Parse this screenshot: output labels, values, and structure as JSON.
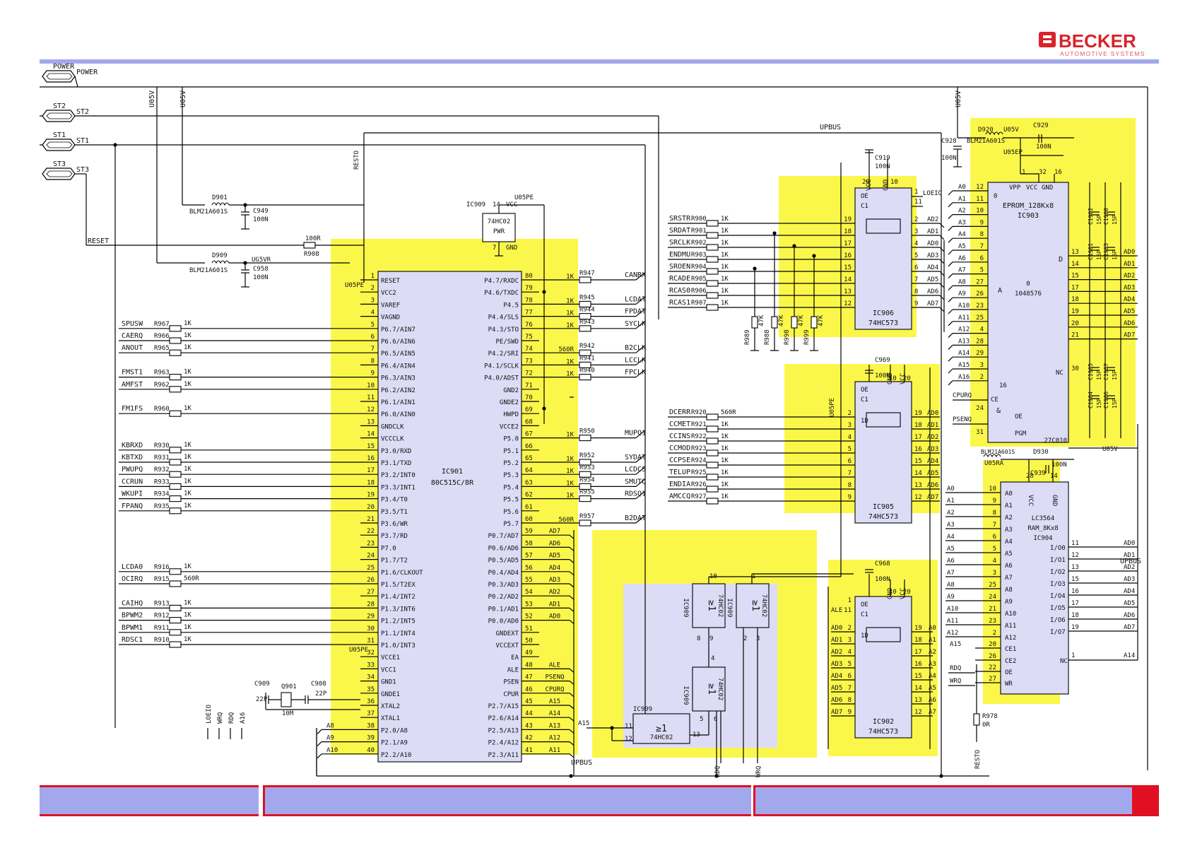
{
  "brand": {
    "name": "BECKER",
    "tagline": "AUTOMOTIVE SYSTEMS",
    "color_red": "#d8232a",
    "color_accent": "#a3a8ec",
    "color_highlight": "#fbf74a",
    "color_chip": "#dcdcf6"
  },
  "connectors": [
    {
      "id": "POWER",
      "net": "POWER"
    },
    {
      "id": "ST2",
      "net": "ST2"
    },
    {
      "id": "ST1",
      "net": "ST1"
    },
    {
      "id": "ST3",
      "net": "ST3"
    }
  ],
  "nets": {
    "reset": "RESET",
    "resto": "RESTO",
    "u05v_a": "U05V",
    "u05v_b": "U05V",
    "u05v_right": "U05V",
    "upbus_top": "UPBUS",
    "upbus_mid": "UPBUS",
    "upbus_right": "UPBUS",
    "u05pe_a": "U05PE",
    "u05pe_b": "U05PE",
    "u05pe_c": "U05PE",
    "u05pe_d": "U05PE",
    "u05pe_e": "U05PE",
    "u05ep": "U05EP",
    "u05ra": "U05RA",
    "ug5vr": "UG5VR",
    "loeio": "LOEIO",
    "wrq": "WRQ",
    "rdq": "RDQ",
    "a16": "A16",
    "a15": "A15",
    "rdq_bottom": "RDQ",
    "wrq_bottom": "WRQ",
    "resto_bottom": "RESTO",
    "ale": "ALE",
    "psenq": "PSENQ",
    "cpurq": "CPURQ",
    "rdq_right": "RDQ",
    "wrq_right": "WRQ"
  },
  "passives": {
    "d901": "D901",
    "d901_type": "BLM21A601S",
    "d909": "D909",
    "d909_type": "BLM21A601S",
    "d920": "D920",
    "d920_type": "BLM21A601S",
    "d930": "D930",
    "d930_type": "BLM21A601S",
    "c949": "C949",
    "c949_val": "100N",
    "c958": "C958",
    "c958_val": "100N",
    "c919": "C919",
    "c919_val": "100N",
    "c928": "C928",
    "c928_val": "100N",
    "c929": "C929",
    "c929_val": "100N",
    "c969": "C969",
    "c969_val": "100N",
    "c968": "C968",
    "c968_val": "100N",
    "c939": "C939",
    "c939_val": "100N",
    "c909": "C909",
    "c909_val": "22P",
    "c908": "C908",
    "c908_val": "22P",
    "q901": "Q901",
    "q901_val": "10M",
    "r908": "R908",
    "r908_val": "100R",
    "r978": "R978",
    "r978_val": "0R",
    "r989": "R989",
    "r988": "R988",
    "r998": "R998",
    "r999": "R999",
    "r47k": "47K",
    "c1902": "C1902",
    "c1900": "C1900",
    "c1901": "C1901",
    "c1903": "C1903",
    "c1905": "C1905",
    "c1907": "C1907",
    "c1904": "C1904",
    "c1906": "C1906",
    "c15p": "15P"
  },
  "left_signals": [
    {
      "net": "SPUSW",
      "res": "R967",
      "val": "1K",
      "pin": "5"
    },
    {
      "net": "CAERQ",
      "res": "R966",
      "val": "1K",
      "pin": "6"
    },
    {
      "net": "ANOUT",
      "res": "R965",
      "val": "1K",
      "pin": "7"
    },
    {
      "net": "FMST1",
      "res": "R963",
      "val": "1K",
      "pin": "9"
    },
    {
      "net": "AMFST",
      "res": "R962",
      "val": "1K",
      "pin": "10"
    },
    {
      "net": "FM1FS",
      "res": "R960",
      "val": "1K",
      "pin": "12"
    },
    {
      "net": "KBRXD",
      "res": "R930",
      "val": "1K",
      "pin": "15"
    },
    {
      "net": "KBTXD",
      "res": "R931",
      "val": "1K",
      "pin": "16"
    },
    {
      "net": "PWUPQ",
      "res": "R932",
      "val": "1K",
      "pin": "17"
    },
    {
      "net": "CCRUN",
      "res": "R933",
      "val": "1K",
      "pin": "18"
    },
    {
      "net": "WKUPI",
      "res": "R934",
      "val": "1K",
      "pin": "19"
    },
    {
      "net": "FPANQ",
      "res": "R935",
      "val": "1K",
      "pin": "20"
    },
    {
      "net": "LCDA0",
      "res": "R916",
      "val": "1K",
      "pin": "25"
    },
    {
      "net": "OCIRQ",
      "res": "R915",
      "val": "560R",
      "pin": "26"
    },
    {
      "net": "CAIHQ",
      "res": "R913",
      "val": "1K",
      "pin": "28"
    },
    {
      "net": "BPWM2",
      "res": "R912",
      "val": "1K",
      "pin": "29"
    },
    {
      "net": "BPWM1",
      "res": "R911",
      "val": "1K",
      "pin": "30"
    },
    {
      "net": "RDSC1",
      "res": "R910",
      "val": "1K",
      "pin": "31"
    }
  ],
  "ic901": {
    "ref": "IC901",
    "part": "80C515C/8R",
    "left_pins": [
      {
        "n": "1",
        "name": "RESET"
      },
      {
        "n": "2",
        "name": "VCC2"
      },
      {
        "n": "3",
        "name": "VAREF"
      },
      {
        "n": "4",
        "name": "VAGND"
      },
      {
        "n": "5",
        "name": "P6.7/AIN7"
      },
      {
        "n": "6",
        "name": "P6.6/AIN6"
      },
      {
        "n": "7",
        "name": "P6.5/AIN5"
      },
      {
        "n": "8",
        "name": "P6.4/AIN4"
      },
      {
        "n": "9",
        "name": "P6.3/AIN3"
      },
      {
        "n": "10",
        "name": "P6.2/AIN2"
      },
      {
        "n": "11",
        "name": "P6.1/AIN1"
      },
      {
        "n": "12",
        "name": "P6.0/AIN0"
      },
      {
        "n": "13",
        "name": "GNDCLK"
      },
      {
        "n": "14",
        "name": "VCCCLK"
      },
      {
        "n": "15",
        "name": "P3.0/RXD"
      },
      {
        "n": "16",
        "name": "P3.1/TXD"
      },
      {
        "n": "17",
        "name": "P3.2/INT0"
      },
      {
        "n": "18",
        "name": "P3.3/INT1"
      },
      {
        "n": "19",
        "name": "P3.4/T0"
      },
      {
        "n": "20",
        "name": "P3.5/T1"
      },
      {
        "n": "21",
        "name": "P3.6/WR"
      },
      {
        "n": "22",
        "name": "P3.7/RD"
      },
      {
        "n": "23",
        "name": "P7.0"
      },
      {
        "n": "24",
        "name": "P1.7/T2"
      },
      {
        "n": "25",
        "name": "P1.6/CLKOUT"
      },
      {
        "n": "26",
        "name": "P1.5/T2EX"
      },
      {
        "n": "27",
        "name": "P1.4/INT2"
      },
      {
        "n": "28",
        "name": "P1.3/INT6"
      },
      {
        "n": "29",
        "name": "P1.2/INT5"
      },
      {
        "n": "30",
        "name": "P1.1/INT4"
      },
      {
        "n": "31",
        "name": "P1.0/INT3"
      },
      {
        "n": "32",
        "name": "VCCE1"
      },
      {
        "n": "33",
        "name": "VCC1"
      },
      {
        "n": "34",
        "name": "GND1"
      },
      {
        "n": "35",
        "name": "GNDE1"
      },
      {
        "n": "36",
        "name": "XTAL2"
      },
      {
        "n": "37",
        "name": "XTAL1"
      },
      {
        "n": "38",
        "name": "P2.0/A8"
      },
      {
        "n": "39",
        "name": "P2.1/A9"
      },
      {
        "n": "40",
        "name": "P2.2/A10"
      }
    ],
    "right_pins": [
      {
        "n": "80",
        "name": "P4.7/RXDC",
        "res": "R947",
        "rv": "1K",
        "net": "CANRX"
      },
      {
        "n": "79",
        "name": "P4.6/TXDC",
        "res": "",
        "rv": "",
        "net": ""
      },
      {
        "n": "78",
        "name": "P4.5",
        "res": "R945",
        "rv": "1K",
        "net": "LCDAT"
      },
      {
        "n": "77",
        "name": "P4.4/SLS",
        "res": "R944",
        "rv": "1K",
        "net": "FPDAT"
      },
      {
        "n": "76",
        "name": "P4.3/STO",
        "res": "R943",
        "rv": "1K",
        "net": "SYCLK"
      },
      {
        "n": "75",
        "name": "PE/SWD",
        "res": "",
        "rv": "",
        "net": ""
      },
      {
        "n": "74",
        "name": "P4.2/SRI",
        "res": "R942",
        "rv": "560R",
        "net": "B2CLK"
      },
      {
        "n": "73",
        "name": "P4.1/SCLK",
        "res": "R941",
        "rv": "1K",
        "net": "LCCLK"
      },
      {
        "n": "72",
        "name": "P4.0/ADST",
        "res": "R940",
        "rv": "1K",
        "net": "FPCLK"
      },
      {
        "n": "71",
        "name": "GND2",
        "res": "",
        "rv": "",
        "net": ""
      },
      {
        "n": "70",
        "name": "GNDE2",
        "res": "",
        "rv": "",
        "net": ""
      },
      {
        "n": "69",
        "name": "HWPD",
        "res": "",
        "rv": "",
        "net": ""
      },
      {
        "n": "68",
        "name": "VCCE2",
        "res": "",
        "rv": "",
        "net": ""
      },
      {
        "n": "67",
        "name": "P5.0",
        "res": "R950",
        "rv": "1K",
        "net": "MUPQ1"
      },
      {
        "n": "66",
        "name": "P5.1",
        "res": "",
        "rv": "",
        "net": ""
      },
      {
        "n": "65",
        "name": "P5.2",
        "res": "R952",
        "rv": "1K",
        "net": "SYDAT"
      },
      {
        "n": "64",
        "name": "P5.3",
        "res": "R953",
        "rv": "1K",
        "net": "LCDCS"
      },
      {
        "n": "63",
        "name": "P5.4",
        "res": "R954",
        "rv": "1K",
        "net": "SMUTQ"
      },
      {
        "n": "62",
        "name": "P5.5",
        "res": "R955",
        "rv": "1K",
        "net": "RDSQ1"
      },
      {
        "n": "61",
        "name": "P5.6",
        "res": "",
        "rv": "",
        "net": ""
      },
      {
        "n": "60",
        "name": "P5.7",
        "res": "R957",
        "rv": "560R",
        "net": "B2DAT"
      },
      {
        "n": "59",
        "name": "P0.7/AD7",
        "res": "",
        "rv": "",
        "net": "AD7"
      },
      {
        "n": "58",
        "name": "P0.6/AD6",
        "res": "",
        "rv": "",
        "net": "AD6"
      },
      {
        "n": "57",
        "name": "P0.5/AD5",
        "res": "",
        "rv": "",
        "net": "AD5"
      },
      {
        "n": "56",
        "name": "P0.4/AD4",
        "res": "",
        "rv": "",
        "net": "AD4"
      },
      {
        "n": "55",
        "name": "P0.3/AD3",
        "res": "",
        "rv": "",
        "net": "AD3"
      },
      {
        "n": "54",
        "name": "P0.2/AD2",
        "res": "",
        "rv": "",
        "net": "AD2"
      },
      {
        "n": "53",
        "name": "P0.1/AD1",
        "res": "",
        "rv": "",
        "net": "AD1"
      },
      {
        "n": "52",
        "name": "P0.0/AD0",
        "res": "",
        "rv": "",
        "net": "AD0"
      },
      {
        "n": "51",
        "name": "GNDEXT",
        "res": "",
        "rv": "",
        "net": ""
      },
      {
        "n": "50",
        "name": "VCCEXT",
        "res": "",
        "rv": "",
        "net": ""
      },
      {
        "n": "49",
        "name": "EA",
        "res": "",
        "rv": "",
        "net": ""
      },
      {
        "n": "48",
        "name": "ALE",
        "res": "",
        "rv": "",
        "net": "ALE"
      },
      {
        "n": "47",
        "name": "PSEN",
        "res": "",
        "rv": "",
        "net": "PSENQ"
      },
      {
        "n": "46",
        "name": "CPUR",
        "res": "",
        "rv": "",
        "net": "CPURQ"
      },
      {
        "n": "45",
        "name": "P2.7/A15",
        "res": "",
        "rv": "",
        "net": "A15"
      },
      {
        "n": "44",
        "name": "P2.6/A14",
        "res": "",
        "rv": "",
        "net": "A14"
      },
      {
        "n": "43",
        "name": "P2.5/A13",
        "res": "",
        "rv": "",
        "net": "A13"
      },
      {
        "n": "42",
        "name": "P2.4/A12",
        "res": "",
        "rv": "",
        "net": "A12"
      },
      {
        "n": "41",
        "name": "P2.3/A11",
        "res": "",
        "rv": "",
        "net": "A11"
      }
    ],
    "bottom_left_nets": [
      "A8",
      "A9",
      "A10"
    ]
  },
  "ic909_pwr": {
    "ref": "IC909",
    "part": "74HC02",
    "sub": "PWR",
    "pin14": "14",
    "pin7": "7",
    "vcc": "VCC",
    "gnd": "GND"
  },
  "ic906": {
    "ref": "IC906",
    "part": "74HC573",
    "pins_top": [
      "20",
      "10"
    ],
    "pins_top_names": [
      "VCC",
      "GND"
    ],
    "oe": "OE",
    "c1": "C1",
    "oe_pin": "1",
    "c1_pin": "11",
    "rows": [
      {
        "net": "SRSTR",
        "res": "R900",
        "rv": "1K",
        "in": "19",
        "out": "2",
        "ad": "AD2"
      },
      {
        "net": "SRDAT",
        "res": "R901",
        "rv": "1K",
        "in": "18",
        "out": "3",
        "ad": "AD1"
      },
      {
        "net": "SRCLK",
        "res": "R902",
        "rv": "1K",
        "in": "17",
        "out": "4",
        "ad": "AD0"
      },
      {
        "net": "ENDMU",
        "res": "R903",
        "rv": "1K",
        "in": "16",
        "out": "5",
        "ad": "AD3"
      },
      {
        "net": "SROEN",
        "res": "R904",
        "rv": "1K",
        "in": "15",
        "out": "6",
        "ad": "AD4"
      },
      {
        "net": "RCADE",
        "res": "R905",
        "rv": "1K",
        "in": "14",
        "out": "7",
        "ad": "AD5"
      },
      {
        "net": "RCAS0",
        "res": "R906",
        "rv": "1K",
        "in": "13",
        "out": "8",
        "ad": "AD6"
      },
      {
        "net": "RCAS1",
        "res": "R907",
        "rv": "1K",
        "in": "12",
        "out": "9",
        "ad": "AD7"
      }
    ]
  },
  "ic905": {
    "ref": "IC905",
    "part": "74HC573",
    "pins_top": [
      "10",
      "20"
    ],
    "pins_top_names": [
      "GND",
      "VCC"
    ],
    "oe": "OE",
    "c1": "C1",
    "d": "1D",
    "rows": [
      {
        "net": "DCERR",
        "res": "R920",
        "rv": "560R",
        "in": "2",
        "out": "19",
        "ad": "AD0"
      },
      {
        "net": "CCMET",
        "res": "R921",
        "rv": "1K",
        "in": "3",
        "out": "18",
        "ad": "AD1"
      },
      {
        "net": "CCINS",
        "res": "R922",
        "rv": "1K",
        "in": "4",
        "out": "17",
        "ad": "AD2"
      },
      {
        "net": "CCMOD",
        "res": "R923",
        "rv": "1K",
        "in": "5",
        "out": "16",
        "ad": "AD3"
      },
      {
        "net": "CCPSE",
        "res": "R924",
        "rv": "1K",
        "in": "6",
        "out": "15",
        "ad": "AD4"
      },
      {
        "net": "TELUP",
        "res": "R925",
        "rv": "1K",
        "in": "7",
        "out": "14",
        "ad": "AD5"
      },
      {
        "net": "ENDIA",
        "res": "R926",
        "rv": "1K",
        "in": "8",
        "out": "13",
        "ad": "AD6"
      },
      {
        "net": "AMCCQ",
        "res": "R927",
        "rv": "1K",
        "in": "9",
        "out": "12",
        "ad": "AD7"
      }
    ]
  },
  "ic902": {
    "ref": "IC902",
    "part": "74HC573",
    "pins_top": [
      "10",
      "20"
    ],
    "pins_top_names": [
      "GND",
      "VCC"
    ],
    "oe": "OE",
    "c1": "C1",
    "d": "1D",
    "oe_pin": "1",
    "c1_pin": "11",
    "rows": [
      {
        "in_net": "AD0",
        "in": "2",
        "out": "19",
        "a": "A0"
      },
      {
        "in_net": "AD1",
        "in": "3",
        "out": "18",
        "a": "A1"
      },
      {
        "in_net": "AD2",
        "in": "4",
        "out": "17",
        "a": "A2"
      },
      {
        "in_net": "AD3",
        "in": "5",
        "out": "16",
        "a": "A3"
      },
      {
        "in_net": "AD4",
        "in": "6",
        "out": "15",
        "a": "A4"
      },
      {
        "in_net": "AD5",
        "in": "7",
        "out": "14",
        "a": "A5"
      },
      {
        "in_net": "AD6",
        "in": "8",
        "out": "13",
        "a": "A6"
      },
      {
        "in_net": "AD7",
        "in": "9",
        "out": "12",
        "a": "A7"
      }
    ]
  },
  "gates": {
    "ic909": "IC909",
    "part": "74HC02",
    "sym": "≥1",
    "g1_pins": [
      "10",
      "9",
      "8"
    ],
    "g2_pins": [
      "1",
      "2",
      "3"
    ],
    "g3_pins": [
      "4",
      "5",
      "6"
    ],
    "g4_pins": [
      "11",
      "12",
      "13"
    ]
  },
  "ic903": {
    "ref": "IC903",
    "part": "EPROM_128Kx8",
    "part2": "27C010",
    "vpp": "VPP",
    "vcc": "VCC",
    "gnd": "GND",
    "vpp_pin": "1",
    "vcc_pin": "32",
    "gnd_pin": "16",
    "a_label": "A",
    "range": "0 / 1048576",
    "zero": "0",
    "d": "D",
    "nc": "NC",
    "nc_pin": "30",
    "ce": "CE",
    "oe": "OE",
    "pgm": "PGM",
    "amp": "&",
    "addr": [
      {
        "net": "A0",
        "pin": "12"
      },
      {
        "net": "A1",
        "pin": "11"
      },
      {
        "net": "A2",
        "pin": "10"
      },
      {
        "net": "A3",
        "pin": "9"
      },
      {
        "net": "A4",
        "pin": "8"
      },
      {
        "net": "A5",
        "pin": "7"
      },
      {
        "net": "A6",
        "pin": "6"
      },
      {
        "net": "A7",
        "pin": "5"
      },
      {
        "net": "A8",
        "pin": "27"
      },
      {
        "net": "A9",
        "pin": "26"
      },
      {
        "net": "A10",
        "pin": "23"
      },
      {
        "net": "A11",
        "pin": "25"
      },
      {
        "net": "A12",
        "pin": "4"
      },
      {
        "net": "A13",
        "pin": "28"
      },
      {
        "net": "A14",
        "pin": "29"
      },
      {
        "net": "A15",
        "pin": "3"
      },
      {
        "net": "A16",
        "pin": "2"
      }
    ],
    "data": [
      {
        "net": "AD0",
        "pin": "13"
      },
      {
        "net": "AD1",
        "pin": "14"
      },
      {
        "net": "AD2",
        "pin": "15"
      },
      {
        "net": "AD3",
        "pin": "17"
      },
      {
        "net": "AD4",
        "pin": "18"
      },
      {
        "net": "AD5",
        "pin": "19"
      },
      {
        "net": "AD6",
        "pin": "20"
      },
      {
        "net": "AD7",
        "pin": "21"
      }
    ],
    "ce_pin": "22",
    "oe_pin": "24",
    "pgm_pin": "31"
  },
  "ic904": {
    "ref": "IC904",
    "part": "LC3564",
    "part2": "RAM_8Kx8",
    "vcc": "VCC",
    "gnd": "GND",
    "vcc_pin": "28",
    "gnd_pin": "14",
    "nc": "NC",
    "nc_pin": "1",
    "ce1": "CE1",
    "ce2": "CE2",
    "oe": "OE",
    "wr": "WR",
    "ce1_pin": "20",
    "ce2_pin": "26",
    "oe_pin": "22",
    "wr_pin": "27",
    "addr": [
      {
        "net": "A0",
        "pin": "10",
        "name": "A0"
      },
      {
        "net": "A1",
        "pin": "9",
        "name": "A1"
      },
      {
        "net": "A2",
        "pin": "8",
        "name": "A2"
      },
      {
        "net": "A3",
        "pin": "7",
        "name": "A3"
      },
      {
        "net": "A4",
        "pin": "6",
        "name": "A4"
      },
      {
        "net": "A5",
        "pin": "5",
        "name": "A5"
      },
      {
        "net": "A6",
        "pin": "4",
        "name": "A6"
      },
      {
        "net": "A7",
        "pin": "3",
        "name": "A7"
      },
      {
        "net": "A8",
        "pin": "25",
        "name": "A8"
      },
      {
        "net": "A9",
        "pin": "24",
        "name": "A9"
      },
      {
        "net": "A10",
        "pin": "21",
        "name": "A10"
      },
      {
        "net": "A11",
        "pin": "23",
        "name": "A11"
      },
      {
        "net": "A12",
        "pin": "2",
        "name": "A12"
      },
      {
        "net": "A15",
        "pin": "",
        "name": ""
      }
    ],
    "io": [
      {
        "name": "I/O0",
        "pin": "11",
        "net": "AD0"
      },
      {
        "name": "I/O1",
        "pin": "12",
        "net": "AD1"
      },
      {
        "name": "I/O2",
        "pin": "13",
        "net": "AD2"
      },
      {
        "name": "I/O3",
        "pin": "15",
        "net": "AD3"
      },
      {
        "name": "I/O4",
        "pin": "16",
        "net": "AD4"
      },
      {
        "name": "I/O5",
        "pin": "17",
        "net": "AD5"
      },
      {
        "name": "I/O6",
        "pin": "18",
        "net": "AD6"
      },
      {
        "name": "I/O7",
        "pin": "19",
        "net": "AD7"
      }
    ],
    "a14": "A14"
  }
}
